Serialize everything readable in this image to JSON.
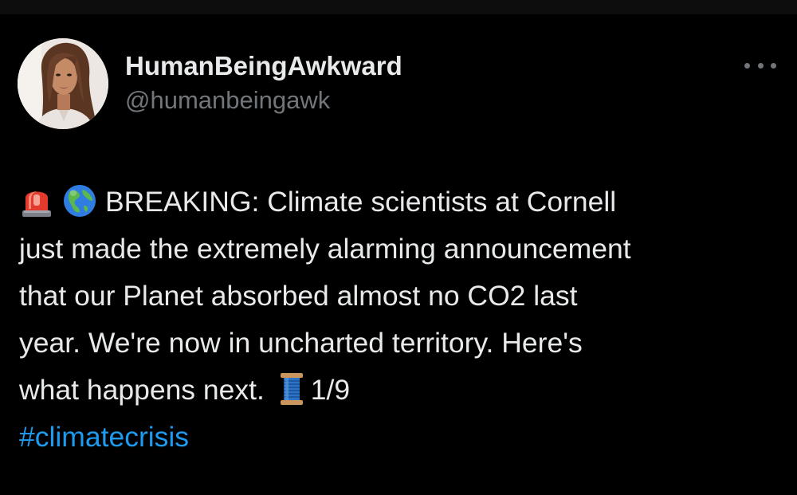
{
  "author": {
    "display_name": "HumanBeingAwkward",
    "handle": "@humanbeingawk",
    "avatar_icon": "profile-photo"
  },
  "more_menu": {
    "icon": "more-horizontal-icon"
  },
  "tweet": {
    "emoji_1": "rotating-light-emoji",
    "emoji_2": "globe-americas-emoji",
    "line_1": "BREAKING: Climate scientists at Cornell",
    "line_2": "just made the extremely alarming announcement",
    "line_3": "that our Planet absorbed almost no CO2 last",
    "line_4": "year. We're now in uncharted territory. Here's",
    "line_5_before": "what happens next.",
    "emoji_3": "thread-spool-emoji",
    "line_5_after": "1/9",
    "hashtag": "#climatecrisis"
  },
  "colors": {
    "background": "#000000",
    "text": "#e7e9ea",
    "secondary": "#71767b",
    "link": "#1d9bf0"
  }
}
